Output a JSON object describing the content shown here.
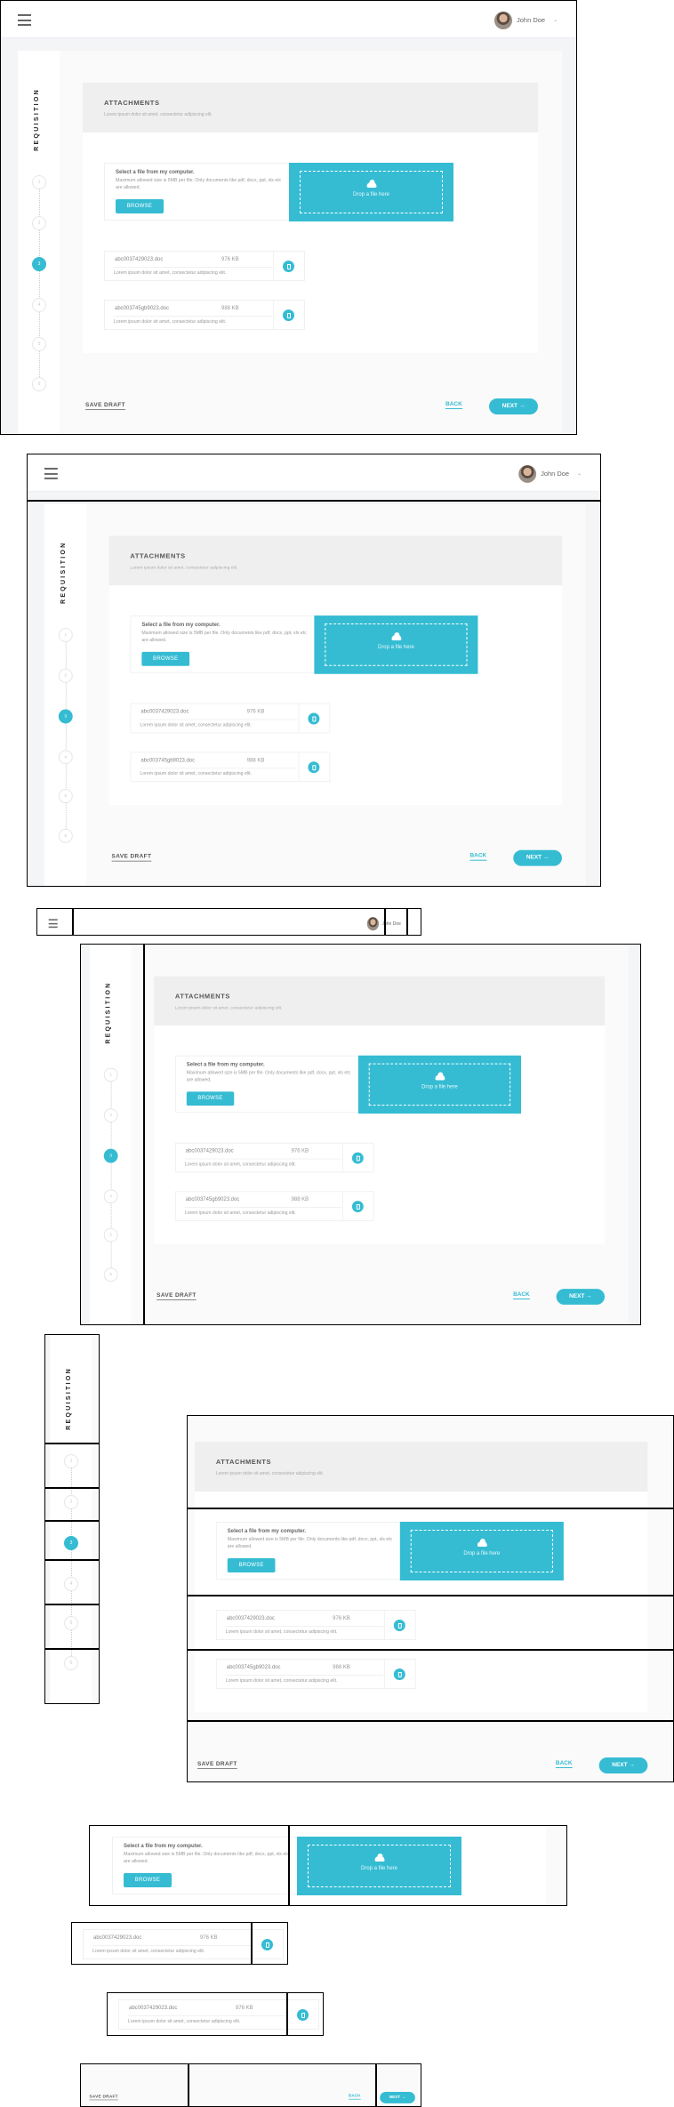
{
  "header": {
    "user_name": "John Doe"
  },
  "sidebar": {
    "title": "REQUISITION",
    "steps": [
      "1",
      "2",
      "3",
      "4",
      "5",
      "6"
    ],
    "active_step": 3
  },
  "section": {
    "title": "ATTACHMENTS",
    "subtitle": "Lorem ipsum dolor sit amet, consectetur adipiscing elit."
  },
  "upload": {
    "heading": "Select a file from my computer.",
    "description": "Maximum allowed size is 5MB per file. Only documents like pdf, docx, ppt, xls etc are allowed.",
    "browse_label": "BROWSE",
    "drop_label": "Drop a file here"
  },
  "files": [
    {
      "name": "abc0037429023.doc",
      "size": "976 KB",
      "description": "Lorem ipsum dolor sit amet, consectetur adipiscing elit."
    },
    {
      "name": "abc003745gb9023.doc",
      "size": "988 KB",
      "description": "Lorem ipsum dolor sit amet, consectetur adipiscing elit."
    }
  ],
  "footer": {
    "save_draft": "SAVE DRAFT",
    "back": "BACK",
    "next": "NEXT →"
  },
  "colors": {
    "accent": "#35bcd3"
  }
}
